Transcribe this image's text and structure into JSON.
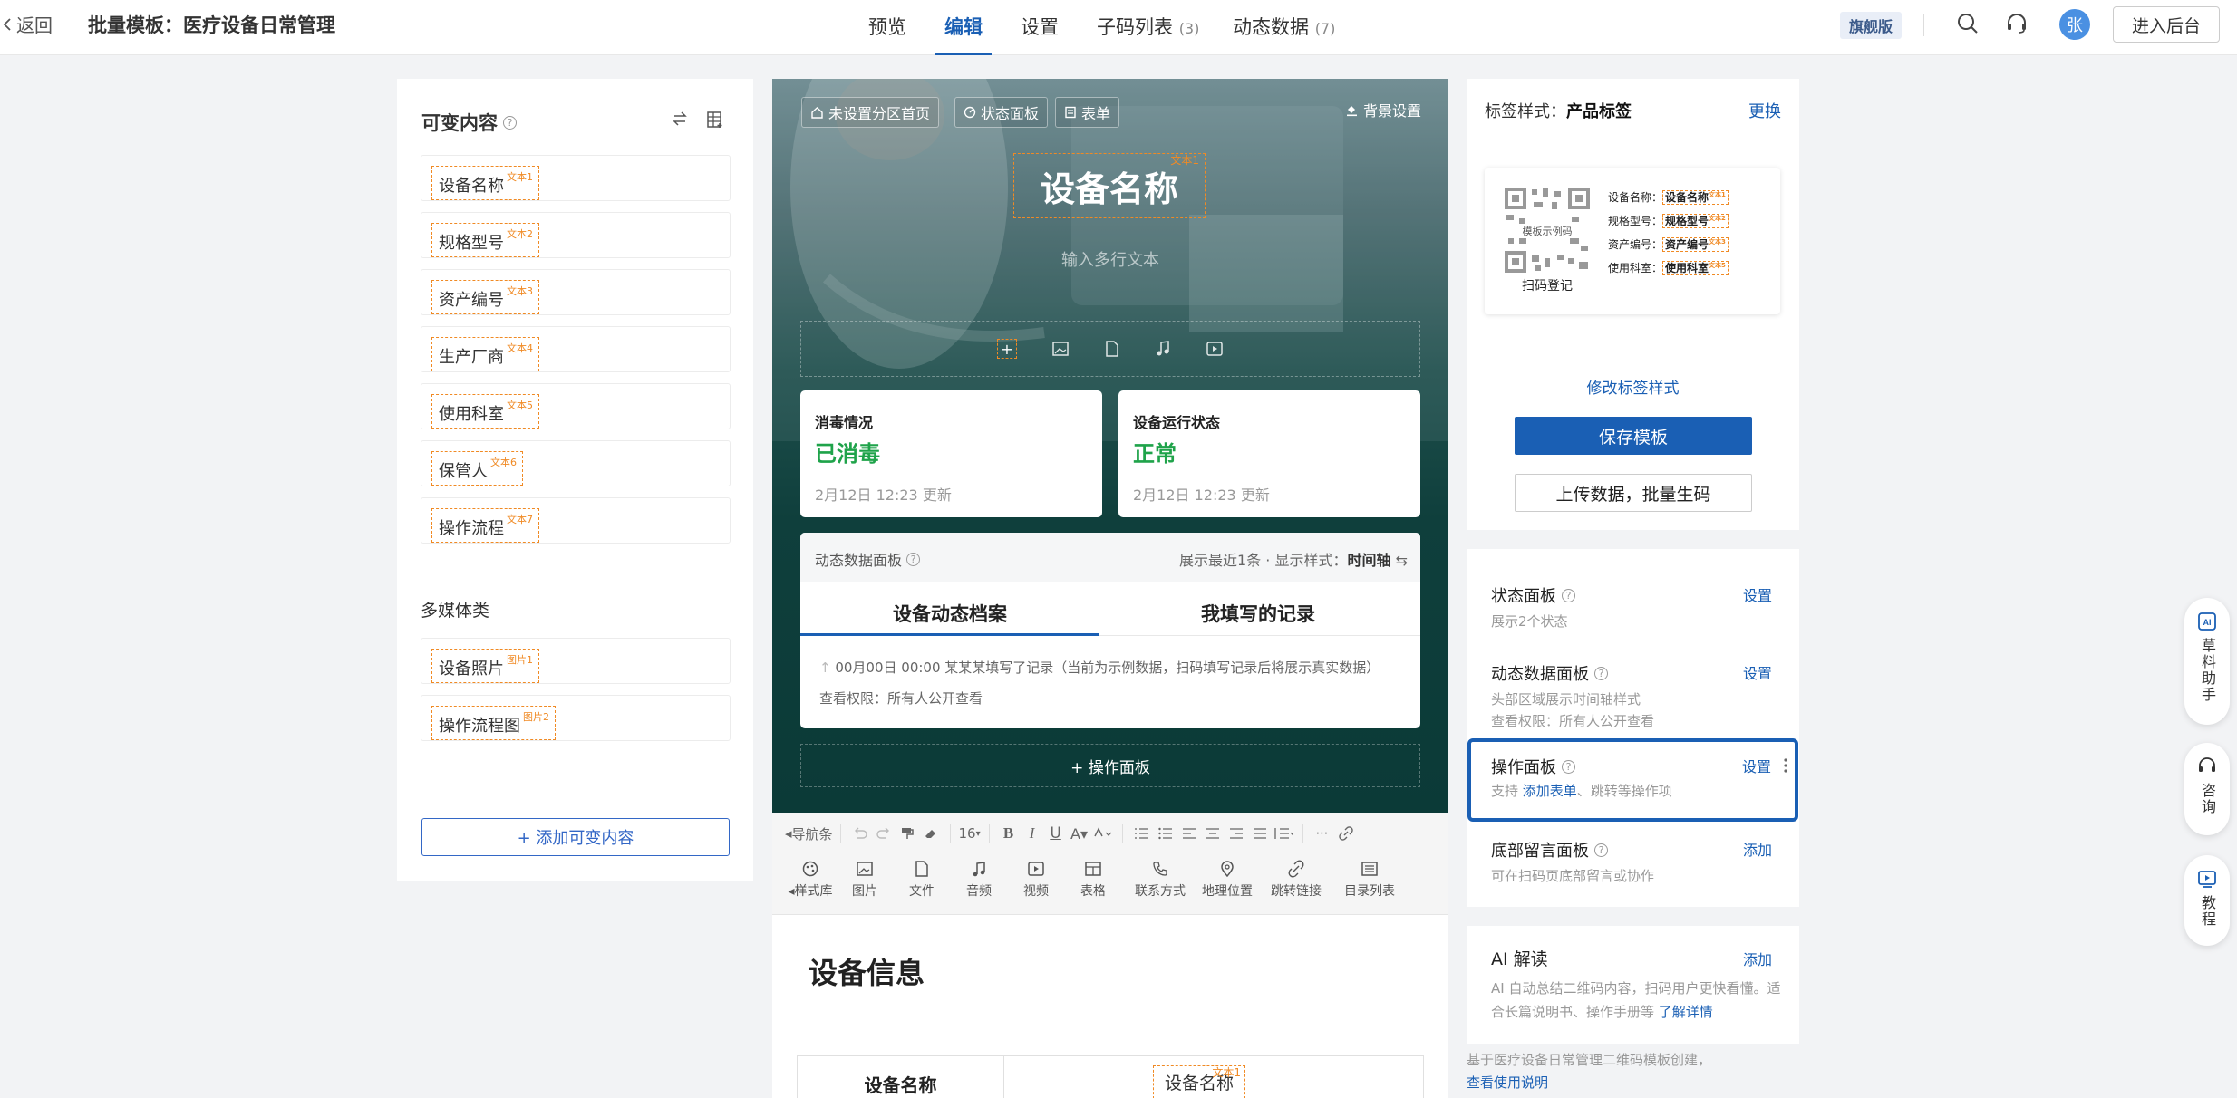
{
  "topbar": {
    "back_label": "返回",
    "title": "批量模板：医疗设备日常管理",
    "tabs": [
      {
        "label": "预览",
        "count": ""
      },
      {
        "label": "编辑",
        "count": ""
      },
      {
        "label": "设置",
        "count": ""
      },
      {
        "label": "子码列表",
        "count": "(3)"
      },
      {
        "label": "动态数据",
        "count": "(7)"
      }
    ],
    "badge": "旗舰版",
    "avatar_text": "张",
    "enter_admin": "进入后台"
  },
  "left_panel": {
    "title": "可变内容",
    "variables": [
      {
        "label": "设备名称",
        "tag": "文本1"
      },
      {
        "label": "规格型号",
        "tag": "文本2"
      },
      {
        "label": "资产编号",
        "tag": "文本3"
      },
      {
        "label": "生产厂商",
        "tag": "文本4"
      },
      {
        "label": "使用科室",
        "tag": "文本5"
      },
      {
        "label": "保管人",
        "tag": "文本6"
      },
      {
        "label": "操作流程",
        "tag": "文本7"
      }
    ],
    "media_title": "多媒体类",
    "media": [
      {
        "label": "设备照片",
        "tag": "图片1"
      },
      {
        "label": "操作流程图",
        "tag": "图片2"
      }
    ],
    "add_button": "+ 添加可变内容"
  },
  "preview": {
    "pills": [
      "未设置分区首页",
      "状态面板",
      "表单"
    ],
    "bg_setting": "背景设置",
    "hero_title": "设备名称",
    "hero_title_tag": "文本1",
    "multiline_placeholder": "输入多行文本",
    "status_cards": [
      {
        "label": "消毒情况",
        "value": "已消毒",
        "updated": "2月12日 12:23 更新"
      },
      {
        "label": "设备运行状态",
        "value": "正常",
        "updated": "2月12日 12:23 更新"
      }
    ],
    "dynamic_panel": {
      "label": "动态数据面板",
      "show_recent": "展示最近1条",
      "display_style_label": "显示样式：",
      "display_style_value": "时间轴",
      "tabs": [
        "设备动态档案",
        "我填写的记录"
      ],
      "record": "00月00日 00:00  某某某填写了记录（当前为示例数据，扫码填写记录后将展示真实数据）",
      "permission": "查看权限：所有人公开查看"
    },
    "op_panel_button": "+ 操作面板",
    "toolbar": {
      "nav": "导航条",
      "font_size": "16",
      "style_lib": "样式库",
      "tools": [
        "图片",
        "文件",
        "音频",
        "视频",
        "表格",
        "联系方式",
        "地理位置",
        "跳转链接",
        "目录列表"
      ]
    },
    "section_title": "设备信息",
    "table_first_col": "设备名称",
    "table_tag": "设备名称",
    "table_tag_sup": "文本1"
  },
  "right_panel": {
    "label_style_prefix": "标签样式：",
    "label_style_value": "产品标签",
    "change": "更换",
    "label_card": {
      "qr_center": "模板示例码",
      "qr_caption": "扫码登记",
      "fields": [
        {
          "name": "设备名称：",
          "value": "设备名称",
          "tag": "文本1"
        },
        {
          "name": "规格型号：",
          "value": "规格型号",
          "tag": "文本2"
        },
        {
          "name": "资产编号：",
          "value": "资产编号",
          "tag": "文本3"
        },
        {
          "name": "使用科室：",
          "value": "使用科室",
          "tag": "文本5"
        }
      ]
    },
    "modify_style": "修改标签样式",
    "save_template": "保存模板",
    "upload_batch": "上传数据，批量生码",
    "panels": [
      {
        "title": "状态面板",
        "action": "设置",
        "desc": "展示2个状态"
      },
      {
        "title": "动态数据面板",
        "action": "设置",
        "desc": "头部区域展示时间轴样式",
        "desc2": "查看权限：所有人公开查看"
      },
      {
        "title": "操作面板",
        "action": "设置",
        "desc_prefix": "支持 ",
        "desc_link": "添加表单",
        "desc_suffix": "、跳转等操作项"
      },
      {
        "title": "底部留言面板",
        "action": "添加",
        "desc": "可在扫码页底部留言或协作"
      }
    ],
    "ai": {
      "title": "AI 解读",
      "action": "添加",
      "desc": "AI 自动总结二维码内容，扫码用户更快看懂。适合长篇说明书、操作手册等 ",
      "link": "了解详情"
    },
    "footnote": "基于医疗设备日常管理二维码模板创建，",
    "footnote_link": "查看使用说明"
  },
  "floating": [
    {
      "label": "草料助手",
      "icon": "ai-icon"
    },
    {
      "label": "咨询",
      "icon": "headset-icon"
    },
    {
      "label": "教程",
      "icon": "play-icon"
    }
  ],
  "colors": {
    "primary": "#1a5fb4",
    "tag_border": "#f08a24",
    "status_green": "#1fa34a"
  }
}
